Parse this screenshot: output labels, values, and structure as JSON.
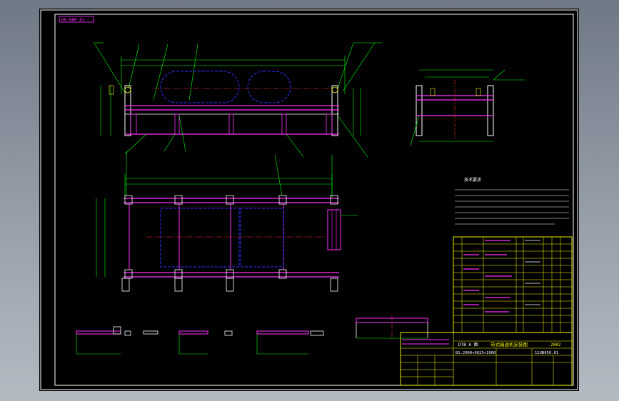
{
  "drawing": {
    "corner_tag": "HG.00P.01",
    "title_block": {
      "company": "DTB A 图",
      "drawing_name": "带式输送机安装图",
      "drawing_no": "12UB050.01",
      "spec": "B1.2000×6025×1000",
      "revision": "2002"
    },
    "notes_title": "技术要求",
    "colors": {
      "background": "#000000",
      "frame": "#ffffff",
      "structure": "#ff2fff",
      "hidden": "#2f2fff",
      "dimension": "#00ff00",
      "center": "#ff3030",
      "text": "#ffff00"
    }
  }
}
